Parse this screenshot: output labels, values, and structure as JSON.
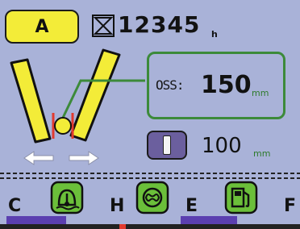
{
  "status": {
    "work_mode": "A",
    "hour_meter_value": "12345",
    "hour_meter_unit": "h"
  },
  "oss": {
    "label": "OSS:",
    "value": "150",
    "unit": "mm"
  },
  "gear": {
    "value": "100",
    "unit": "mm"
  },
  "gauges": {
    "coolant": {
      "low_label": "C",
      "high_label": "H"
    },
    "fuel": {
      "low_label": "E",
      "high_label": "F"
    }
  },
  "colors": {
    "background": "#a9b2d8",
    "yellow": "#f3ec38",
    "green": "#3c8a3a",
    "icon_green": "#6bbf3a",
    "purple": "#6b5f9e",
    "gauge_bar": "#5b3fb0",
    "red": "#e23a2e"
  },
  "icons": {
    "hour_meter": "hourglass-icon",
    "coolant": "coolant-temperature-icon",
    "glow": "glow-plug-icon",
    "fuel": "fuel-pump-icon"
  }
}
